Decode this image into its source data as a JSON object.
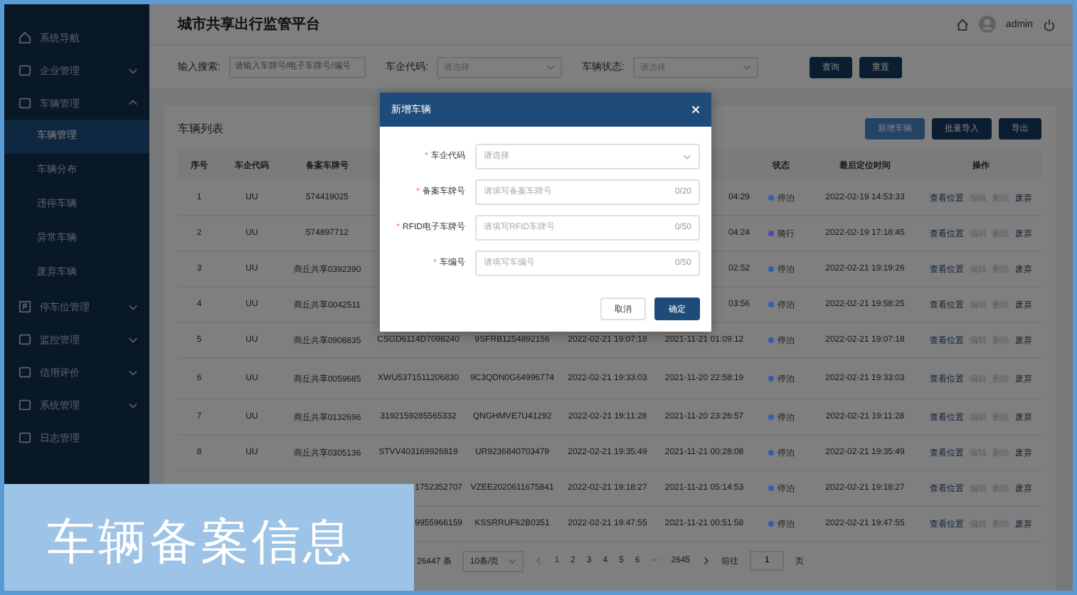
{
  "sidebar": {
    "items": [
      {
        "label": "系统导航",
        "kind": "link"
      },
      {
        "label": "企业管理",
        "kind": "group",
        "expanded": false
      },
      {
        "label": "车辆管理",
        "kind": "group",
        "expanded": true,
        "children": [
          {
            "label": "车辆管理",
            "selected": true
          },
          {
            "label": "车辆分布",
            "selected": false
          },
          {
            "label": "违停车辆",
            "selected": false
          },
          {
            "label": "异常车辆",
            "selected": false
          },
          {
            "label": "废弃车辆",
            "selected": false
          }
        ]
      },
      {
        "label": "停车位管理",
        "kind": "group",
        "expanded": false
      },
      {
        "label": "监控管理",
        "kind": "group",
        "expanded": false
      },
      {
        "label": "信用评价",
        "kind": "group",
        "expanded": false
      },
      {
        "label": "系统管理",
        "kind": "group",
        "expanded": false
      },
      {
        "label": "日志管理",
        "kind": "link"
      }
    ]
  },
  "header": {
    "title": "城市共享出行监管平台",
    "user": "admin"
  },
  "filters": [
    {
      "label": "输入搜索:",
      "kind": "input",
      "placeholder": "请输入车牌号/电子车牌号/编号"
    },
    {
      "label": "车企代码:",
      "kind": "select",
      "placeholder": "请选择"
    },
    {
      "label": "车辆状态:",
      "kind": "select",
      "placeholder": "请选择"
    }
  ],
  "filter_buttons": [
    "查询",
    "重置"
  ],
  "table": {
    "title": "车辆列表",
    "buttons": [
      {
        "label": "新增车辆",
        "kind": "light"
      },
      {
        "label": "批量导入",
        "kind": "dark"
      },
      {
        "label": "导出",
        "kind": "dark"
      }
    ],
    "columns": [
      "序号",
      "车企代码",
      "备案车牌号",
      "状态",
      "最后定位时间",
      "操作"
    ],
    "rows": [
      {
        "no": "1",
        "company": "UU",
        "plate": "574419025",
        "column_7": "04:29",
        "status": "停泊",
        "color": "#2b63b0",
        "last": "2022-02-19 14:53:33",
        "actions": [
          {
            "label": "查看位置",
            "disabled": false
          },
          {
            "label": "编辑",
            "disabled": true
          },
          {
            "label": "删除",
            "disabled": true
          },
          {
            "label": "废弃",
            "disabled": false
          }
        ]
      },
      {
        "no": "2",
        "company": "UU",
        "plate": "574897712",
        "column_7": "04:24",
        "status": "骑行",
        "color": "#5a3fc0",
        "last": "2022-02-19 17:18:45",
        "actions": [
          {
            "label": "查看位置",
            "disabled": false
          },
          {
            "label": "编辑",
            "disabled": true
          },
          {
            "label": "删除",
            "disabled": true
          },
          {
            "label": "废弃",
            "disabled": false
          }
        ]
      },
      {
        "no": "3",
        "company": "UU",
        "plate": "商丘共享0392390",
        "column_7": "02:52",
        "status": "停泊",
        "color": "#2b63b0",
        "last": "2022-02-21 19:19:26",
        "actions": [
          {
            "label": "查看位置",
            "disabled": false
          },
          {
            "label": "编辑",
            "disabled": true
          },
          {
            "label": "删除",
            "disabled": true
          },
          {
            "label": "废弃",
            "disabled": false
          }
        ]
      },
      {
        "no": "4",
        "company": "UU",
        "plate": "商丘共享0042511",
        "column_7": "03:56",
        "status": "停泊",
        "color": "#2b63b0",
        "last": "2022-02-21 19:58:25",
        "actions": [
          {
            "label": "查看位置",
            "disabled": false
          },
          {
            "label": "编辑",
            "disabled": true
          },
          {
            "label": "删除",
            "disabled": true
          },
          {
            "label": "废弃",
            "disabled": false
          }
        ]
      },
      {
        "no": "5",
        "company": "UU",
        "plate": "商丘共享0908835",
        "column_4": "CSGD6114D7098240",
        "column_5": "9SFRB1254892156",
        "column_6": "2022-02-21 19:07:18",
        "column_7": "2021-11-21 01:09:12",
        "status": "停泊",
        "color": "#2b63b0",
        "last": "2022-02-21 19:07:18",
        "actions": [
          {
            "label": "查看位置",
            "disabled": false
          },
          {
            "label": "编辑",
            "disabled": true
          },
          {
            "label": "删除",
            "disabled": true
          },
          {
            "label": "废弃",
            "disabled": false
          }
        ]
      },
      {
        "no": "6",
        "company": "UU",
        "plate": "商丘共享0059685",
        "column_4": "XWU5371511206830",
        "column_5": "9C3QDN0G64996774",
        "column_6": "2022-02-21 19:33:03",
        "column_7": "2021-11-20 22:58:19",
        "status": "停泊",
        "color": "#2b63b0",
        "last": "2022-02-21 19:33:03",
        "actions": [
          {
            "label": "查看位置",
            "disabled": false
          },
          {
            "label": "编辑",
            "disabled": true
          },
          {
            "label": "删除",
            "disabled": true
          },
          {
            "label": "废弃",
            "disabled": false
          }
        ]
      },
      {
        "no": "7",
        "company": "UU",
        "plate": "商丘共享0132696",
        "column_4": "3192159285565332",
        "column_5": "QNGHMVE7U41292",
        "column_6": "2022-02-21 19:11:28",
        "column_7": "2021-11-20 23:26:57",
        "status": "停泊",
        "color": "#2b63b0",
        "last": "2022-02-21 19:11:28",
        "actions": [
          {
            "label": "查看位置",
            "disabled": false
          },
          {
            "label": "编辑",
            "disabled": true
          },
          {
            "label": "删除",
            "disabled": true
          },
          {
            "label": "废弃",
            "disabled": false
          }
        ]
      },
      {
        "no": "8",
        "company": "UU",
        "plate": "商丘共享0305136",
        "column_4": "STVV403169926819",
        "column_5": "UR9236840703479",
        "column_6": "2022-02-21 19:35:49",
        "column_7": "2021-11-21 00:28:08",
        "status": "停泊",
        "color": "#2b63b0",
        "last": "2022-02-21 19:35:49",
        "actions": [
          {
            "label": "查看位置",
            "disabled": false
          },
          {
            "label": "编辑",
            "disabled": true
          },
          {
            "label": "删除",
            "disabled": true
          },
          {
            "label": "废弃",
            "disabled": false
          }
        ]
      },
      {
        "column_4": "1752352707",
        "column_5": "VZEE2020611675841",
        "column_6": "2022-02-21 19:18:27",
        "column_7": "2021-11-21 05:14:53",
        "status": "停泊",
        "color": "#2b63b0",
        "last": "2022-02-21 19:18:27",
        "actions": [
          {
            "label": "查看位置",
            "disabled": false
          },
          {
            "label": "编辑",
            "disabled": true
          },
          {
            "label": "删除",
            "disabled": true
          },
          {
            "label": "废弃",
            "disabled": false
          }
        ]
      },
      {
        "column_4": "9955966159",
        "column_5": "KSSRRUF62B0351",
        "column_6": "2022-02-21 19:47:55",
        "column_7": "2021-11-21 00:51:58",
        "status": "停泊",
        "color": "#2b63b0",
        "last": "2022-02-21 19:47:55",
        "actions": [
          {
            "label": "查看位置",
            "disabled": false
          },
          {
            "label": "编辑",
            "disabled": true
          },
          {
            "label": "删除",
            "disabled": true
          },
          {
            "label": "废弃",
            "disabled": false
          }
        ]
      }
    ]
  },
  "pagination": {
    "total": "26447 条",
    "page_size": "10条/页",
    "pages": [
      {
        "label": "1",
        "selected": true
      },
      {
        "label": "2",
        "selected": false
      },
      {
        "label": "3",
        "selected": false
      },
      {
        "label": "4",
        "selected": false
      },
      {
        "label": "5",
        "selected": false
      },
      {
        "label": "6",
        "selected": false
      },
      {
        "label": "···",
        "selected": false
      },
      {
        "label": "2645",
        "selected": false
      }
    ],
    "goto_label": "前往",
    "goto_value": "1",
    "goto_unit": "页"
  },
  "dialog": {
    "title": "新增车辆",
    "fields": [
      {
        "label": "车企代码",
        "required_mark": "*",
        "kind": "select",
        "placeholder": "请选择"
      },
      {
        "label": "备案车牌号",
        "required_mark": "*",
        "kind": "input",
        "placeholder": "请填写备案车牌号",
        "count": "0/20"
      },
      {
        "label": "RFID电子车牌号",
        "required_mark": "*",
        "kind": "input",
        "placeholder": "请填写RFID车牌号",
        "count": "0/50"
      },
      {
        "label": "车编号",
        "required_mark": "*",
        "kind": "input",
        "placeholder": "请填写车编号",
        "count": "0/50"
      }
    ],
    "buttons": [
      {
        "label": "取消",
        "kind": "default"
      },
      {
        "label": "确定",
        "kind": "primary"
      }
    ]
  },
  "caption": "车辆备案信息"
}
